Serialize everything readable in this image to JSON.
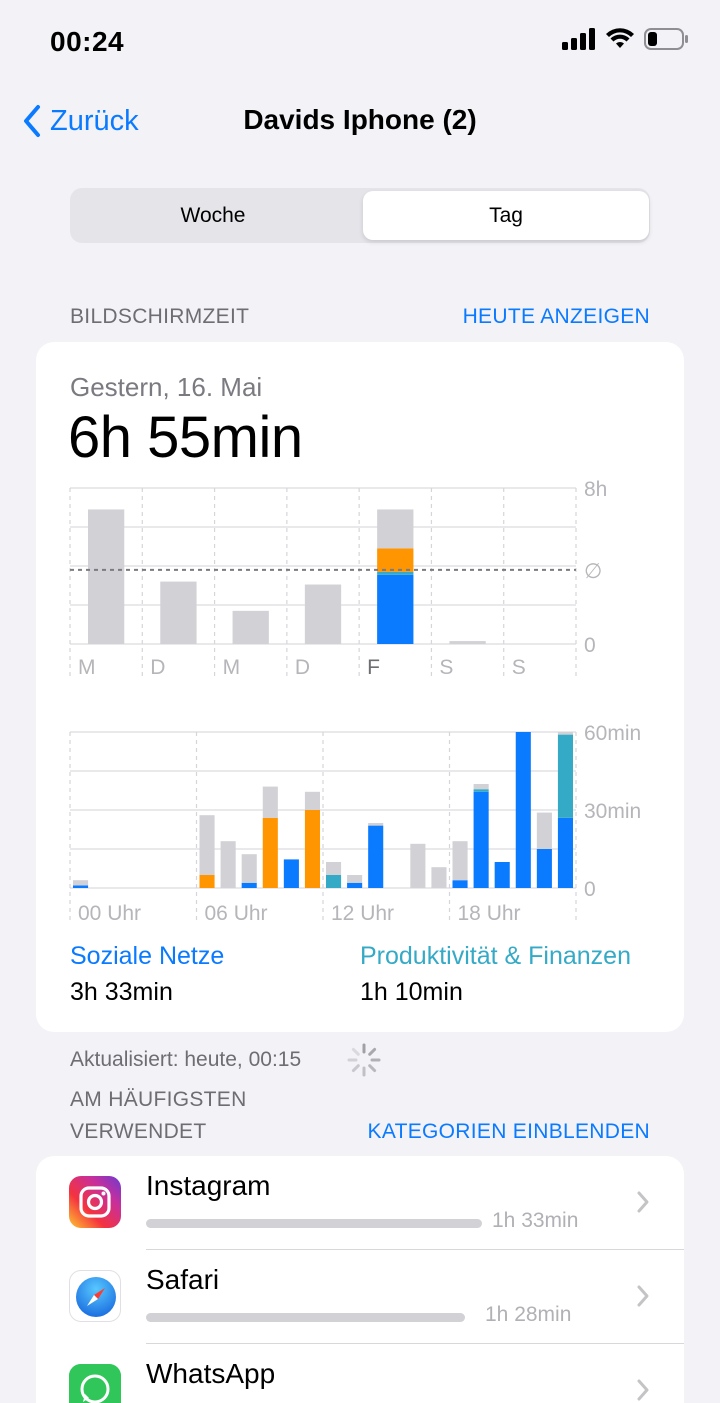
{
  "status": {
    "time": "00:24"
  },
  "nav": {
    "back_label": "Zurück",
    "title": "Davids Iphone (2)"
  },
  "segmented": {
    "left": "Woche",
    "right": "Tag",
    "selected": "Tag"
  },
  "screen_time": {
    "section_label": "BILDSCHIRMZEIT",
    "today_link": "HEUTE ANZEIGEN",
    "date_label": "Gestern, 16. Mai",
    "total": "6h 55min",
    "legend": [
      {
        "name": "Soziale Netze",
        "value": "3h 33min",
        "color": "#0a7aff"
      },
      {
        "name": "Produktivität & Finanzen",
        "value": "1h 10min",
        "color": "#35aac6"
      }
    ],
    "updated": "Aktualisiert: heute, 00:15"
  },
  "chart_data": [
    {
      "type": "bar",
      "categories": [
        "M",
        "D",
        "M",
        "D",
        "F",
        "S",
        "S"
      ],
      "ylim": [
        0,
        8
      ],
      "y_ticks": [
        "0",
        "∅",
        "8h"
      ],
      "average": 3.8,
      "series": [
        {
          "values": [
            0,
            0,
            0,
            0,
            3.55,
            0,
            0
          ],
          "color": "#0a7aff"
        },
        {
          "values": [
            0,
            0,
            0,
            0,
            0.15,
            0,
            0
          ],
          "color": "#35aac6"
        },
        {
          "values": [
            0,
            0,
            0,
            0,
            1.2,
            0,
            0
          ],
          "color": "#ff9500"
        },
        {
          "values": [
            6.9,
            3.2,
            1.7,
            3.05,
            2.0,
            0.15,
            0
          ],
          "color": "#d1d1d6"
        }
      ],
      "highlight": "F"
    },
    {
      "type": "bar",
      "categories": [
        "0",
        "1",
        "2",
        "3",
        "4",
        "5",
        "6",
        "7",
        "8",
        "9",
        "10",
        "11",
        "12",
        "13",
        "14",
        "15",
        "16",
        "17",
        "18",
        "19",
        "20",
        "21",
        "22",
        "23"
      ],
      "x_tick_labels": [
        "00 Uhr",
        "06 Uhr",
        "12 Uhr",
        "18 Uhr"
      ],
      "ylim": [
        0,
        60
      ],
      "y_ticks": [
        "0",
        "30min",
        "60min"
      ],
      "series": [
        {
          "values": [
            1,
            0,
            0,
            0,
            0,
            0,
            0,
            0,
            2,
            0,
            11,
            0,
            0,
            2,
            24,
            0,
            0,
            0,
            3,
            37,
            10,
            60,
            15,
            27
          ],
          "color": "#0a7aff"
        },
        {
          "values": [
            0,
            0,
            0,
            0,
            0,
            0,
            0,
            0,
            0,
            0,
            0,
            0,
            5,
            0,
            0,
            0,
            0,
            0,
            0,
            1,
            0,
            0,
            0,
            32
          ],
          "color": "#35aac6"
        },
        {
          "values": [
            0,
            0,
            0,
            0,
            0,
            0,
            5,
            0,
            0,
            27,
            0,
            30,
            0,
            0,
            0,
            0,
            0,
            0,
            0,
            0,
            0,
            0,
            0,
            0
          ],
          "color": "#ff9500"
        },
        {
          "values": [
            2,
            0,
            0,
            0,
            0,
            0,
            23,
            18,
            11,
            12,
            0,
            7,
            5,
            3,
            1,
            0,
            17,
            8,
            15,
            2,
            0,
            0,
            14,
            1
          ],
          "color": "#d1d1d6"
        }
      ]
    }
  ],
  "most_used": {
    "section_label_line1": "AM HÄUFIGSTEN",
    "section_label_line2": "VERWENDET",
    "categories_link": "KATEGORIEN EINBLENDEN",
    "apps": [
      {
        "name": "Instagram",
        "time": "1h 33min",
        "fraction": 1.0,
        "icon": "instagram-icon"
      },
      {
        "name": "Safari",
        "time": "1h 28min",
        "fraction": 0.95,
        "icon": "safari-icon"
      },
      {
        "name": "WhatsApp",
        "time": "",
        "fraction": 0.6,
        "icon": "whatsapp-icon"
      }
    ]
  }
}
